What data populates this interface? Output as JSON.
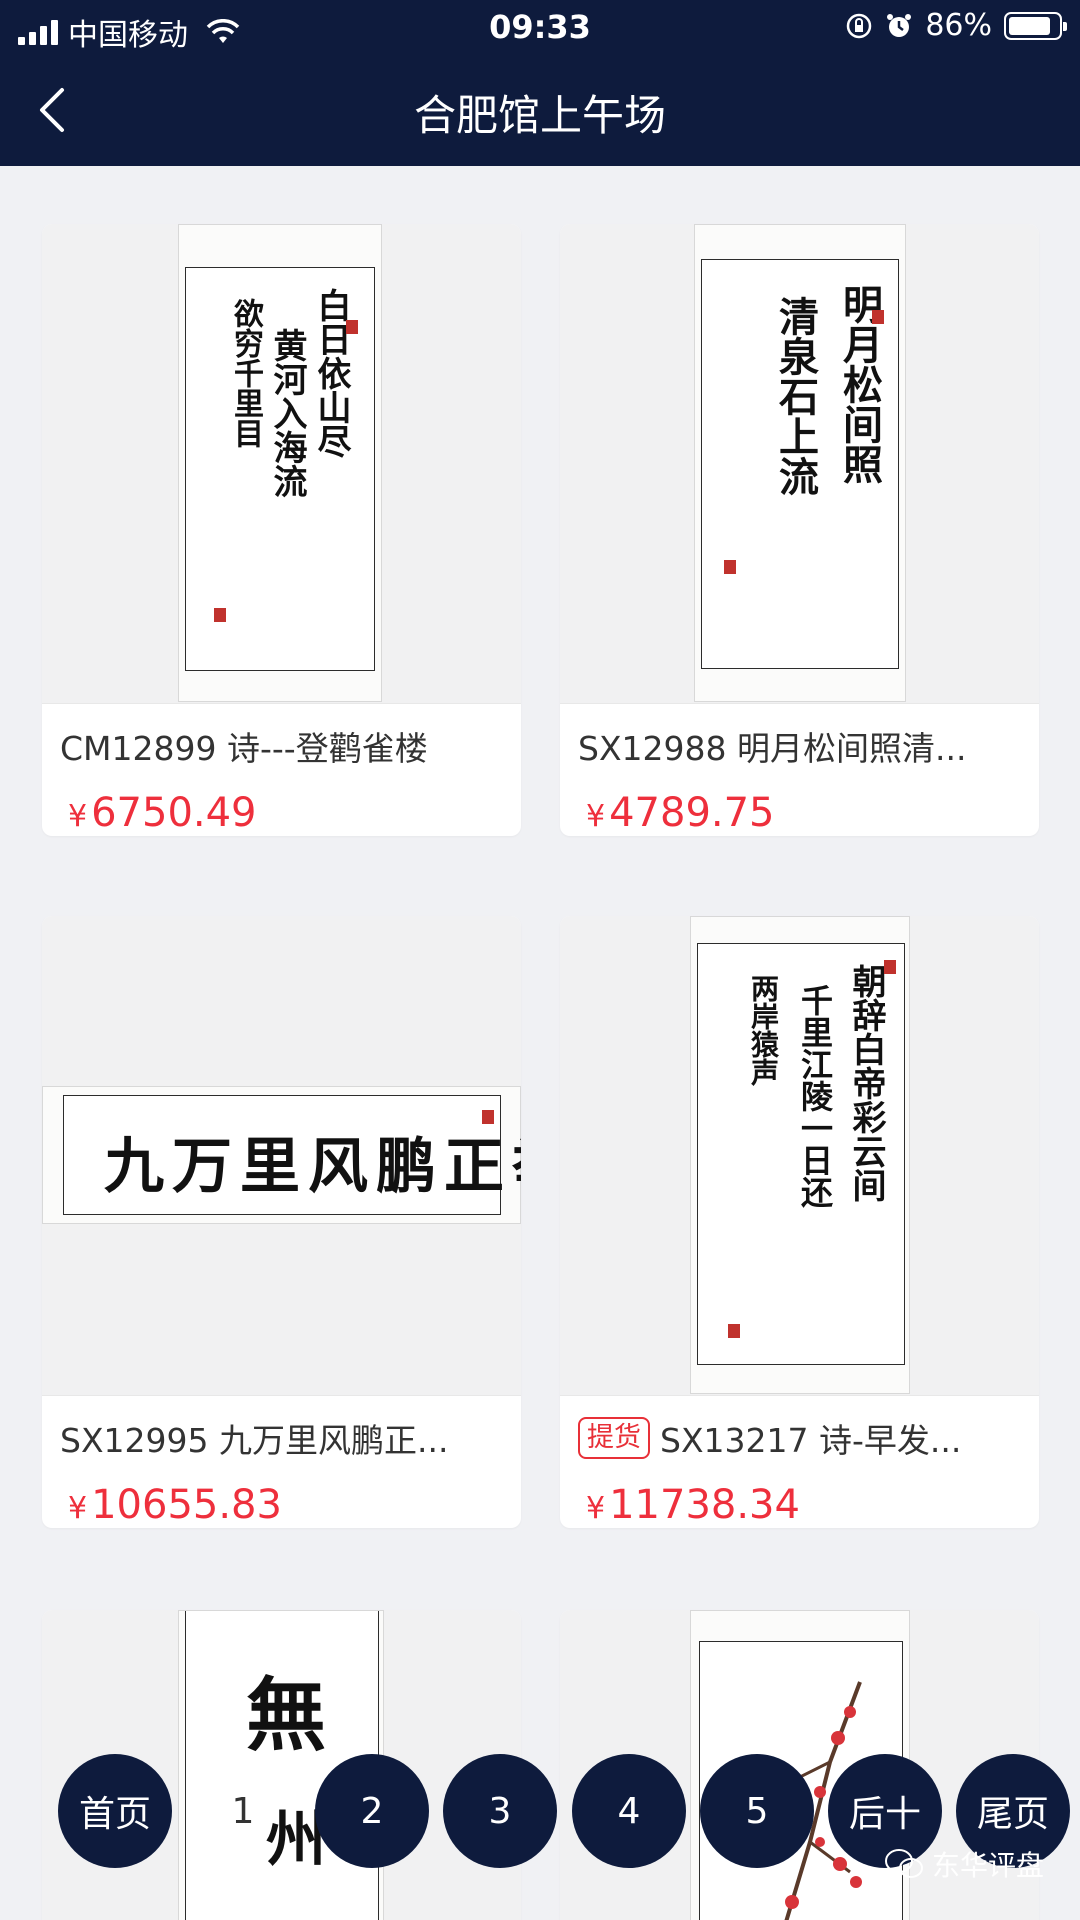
{
  "status_bar": {
    "carrier": "中国移动",
    "time": "09:33",
    "battery_percent": "86%",
    "battery_level": 0.86
  },
  "nav": {
    "title": "合肥馆上午场",
    "back_icon": "chevron-left-icon"
  },
  "products": [
    {
      "name": "CM12899 诗---登鹳雀楼",
      "price_symbol": "¥",
      "price": "6750.49",
      "tag": ""
    },
    {
      "name": "SX12988 明月松间照清...",
      "price_symbol": "¥",
      "price": "4789.75",
      "tag": ""
    },
    {
      "name": "SX12995 九万里风鹏正...",
      "price_symbol": "¥",
      "price": "10655.83",
      "tag": ""
    },
    {
      "name": "SX13217 诗-早发...",
      "price_symbol": "¥",
      "price": "11738.34",
      "tag": "提货"
    },
    {
      "name": "",
      "price_symbol": "",
      "price": "",
      "tag": ""
    },
    {
      "name": "",
      "price_symbol": "",
      "price": "",
      "tag": ""
    }
  ],
  "pagination": {
    "first": "首页",
    "pages": [
      "1",
      "2",
      "3",
      "4",
      "5"
    ],
    "current": "1",
    "next_ten": "后十",
    "last": "尾页"
  },
  "watermark": "东华评盘",
  "colors": {
    "navy": "#0e1b3d",
    "price_red": "#ee2f3c",
    "background": "#f0f1f4"
  }
}
